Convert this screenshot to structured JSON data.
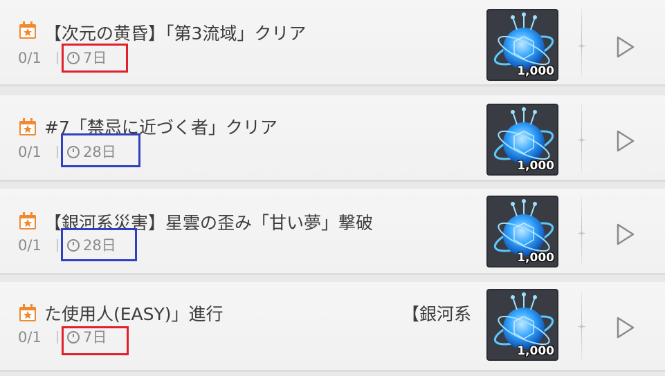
{
  "missions": [
    {
      "title": "【次元の黄昏】「第3流域」クリア",
      "title_extra": "",
      "progress": "0/1",
      "time_left": "7日",
      "reward_count": "1,000",
      "highlight": "red"
    },
    {
      "title": "#7「禁忌に近づく者」クリア",
      "title_extra": "",
      "progress": "0/1",
      "time_left": "28日",
      "reward_count": "1,000",
      "highlight": "blue"
    },
    {
      "title": "【銀河系災害】星雲の歪み「甘い夢」撃破",
      "title_extra": "",
      "progress": "0/1",
      "time_left": "28日",
      "reward_count": "1,000",
      "highlight": "blue"
    },
    {
      "title": "た使用人(EASY)」進行",
      "title_extra": "【銀河系",
      "progress": "0/1",
      "time_left": "7日",
      "reward_count": "1,000",
      "highlight": "red"
    }
  ],
  "colors": {
    "icon_orange": "#f08a30",
    "highlight_red": "#e0202b",
    "highlight_blue": "#3140c0",
    "reward_glow": "#35a6ff"
  },
  "icons": {
    "calendar": "calendar-star-icon",
    "clock": "clock-icon",
    "reward": "crystal-orb-icon",
    "play": "play-triangle-icon"
  }
}
